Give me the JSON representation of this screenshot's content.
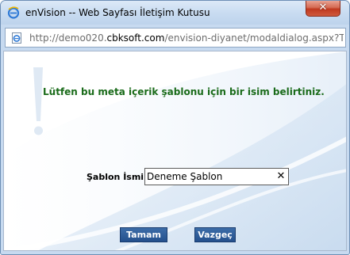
{
  "window": {
    "title": "enVision -- Web Sayfası İletişim Kutusu",
    "close_symbol": "✕"
  },
  "addressbar": {
    "url_prefix": "http://demo020.",
    "url_domain": "cbksoft.com",
    "url_path": "/envision-diyanet/modaldialog.aspx?Type=C"
  },
  "dialog": {
    "message": "Lütfen bu meta içerik şablonu için bir isim belirtiniz.",
    "field_label": "Şablon İsmi :",
    "field_value": "Deneme Şablon",
    "clear_symbol": "✕",
    "ok_label": "Tamam",
    "cancel_label": "Vazgeç"
  },
  "icons": {
    "app": "ie-icon",
    "address": "page-icon",
    "watermark": "exclamation-icon"
  },
  "colors": {
    "message": "#1a6b1a",
    "button": "#24508d",
    "close": "#c0391f"
  }
}
